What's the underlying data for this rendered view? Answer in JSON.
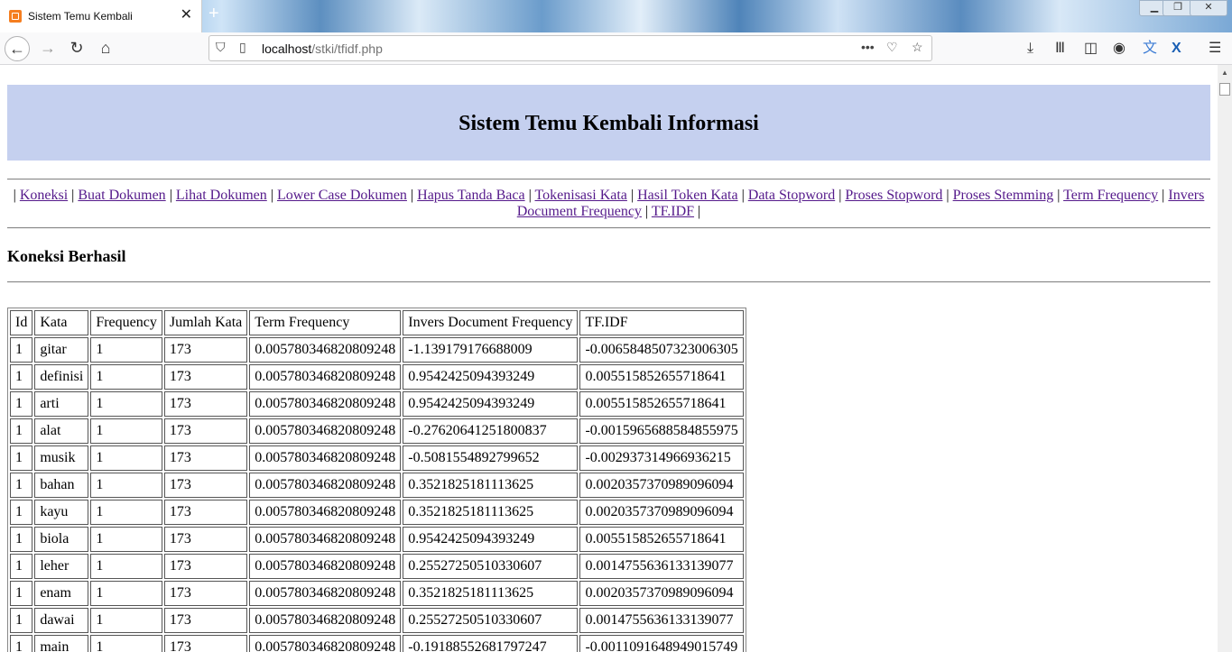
{
  "browser": {
    "tab_title": "Sistem Temu Kembali",
    "url_host": "localhost",
    "url_path": "/stki/tfidf.php",
    "icons": [
      "back-arrow-icon",
      "forward-arrow-icon",
      "reload-icon",
      "home-icon",
      "shield-icon",
      "page-icon",
      "more-icon",
      "pocket-icon",
      "star-icon",
      "download-icon",
      "library-icon",
      "sidebar-icon",
      "account-icon",
      "translate-icon",
      "extension-x-icon",
      "menu-icon"
    ]
  },
  "page": {
    "title": "Sistem Temu Kembali Informasi",
    "status": "Koneksi Berhasil",
    "nav_links": [
      "Koneksi",
      "Buat Dokumen",
      "Lihat Dokumen",
      "Lower Case Dokumen",
      "Hapus Tanda Baca",
      "Tokenisasi Kata",
      "Hasil Token Kata",
      "Data Stopword",
      "Proses Stopword",
      "Proses Stemming",
      "Term Frequency",
      "Invers Document Frequency",
      "TF.IDF"
    ],
    "banner_color": "#c5d0ef"
  },
  "table": {
    "headers": [
      "Id",
      "Kata",
      "Frequency",
      "Jumlah Kata",
      "Term Frequency",
      "Invers Document Frequency",
      "TF.IDF"
    ],
    "rows": [
      [
        "1",
        "gitar",
        "1",
        "173",
        "0.005780346820809248",
        "-1.139179176688009",
        "-0.0065848507323006305"
      ],
      [
        "1",
        "definisi",
        "1",
        "173",
        "0.005780346820809248",
        "0.9542425094393249",
        "0.005515852655718641"
      ],
      [
        "1",
        "arti",
        "1",
        "173",
        "0.005780346820809248",
        "0.9542425094393249",
        "0.005515852655718641"
      ],
      [
        "1",
        "alat",
        "1",
        "173",
        "0.005780346820809248",
        "-0.27620641251800837",
        "-0.0015965688584855975"
      ],
      [
        "1",
        "musik",
        "1",
        "173",
        "0.005780346820809248",
        "-0.5081554892799652",
        "-0.002937314966936215"
      ],
      [
        "1",
        "bahan",
        "1",
        "173",
        "0.005780346820809248",
        "0.3521825181113625",
        "0.0020357370989096094"
      ],
      [
        "1",
        "kayu",
        "1",
        "173",
        "0.005780346820809248",
        "0.3521825181113625",
        "0.0020357370989096094"
      ],
      [
        "1",
        "biola",
        "1",
        "173",
        "0.005780346820809248",
        "0.9542425094393249",
        "0.005515852655718641"
      ],
      [
        "1",
        "leher",
        "1",
        "173",
        "0.005780346820809248",
        "0.25527250510330607",
        "0.0014755636133139077"
      ],
      [
        "1",
        "enam",
        "1",
        "173",
        "0.005780346820809248",
        "0.3521825181113625",
        "0.0020357370989096094"
      ],
      [
        "1",
        "dawai",
        "1",
        "173",
        "0.005780346820809248",
        "0.25527250510330607",
        "0.0014755636133139077"
      ],
      [
        "1",
        "main",
        "1",
        "173",
        "0.005780346820809248",
        "-0.19188552681797247",
        "-0.0011091648949015749"
      ]
    ]
  }
}
